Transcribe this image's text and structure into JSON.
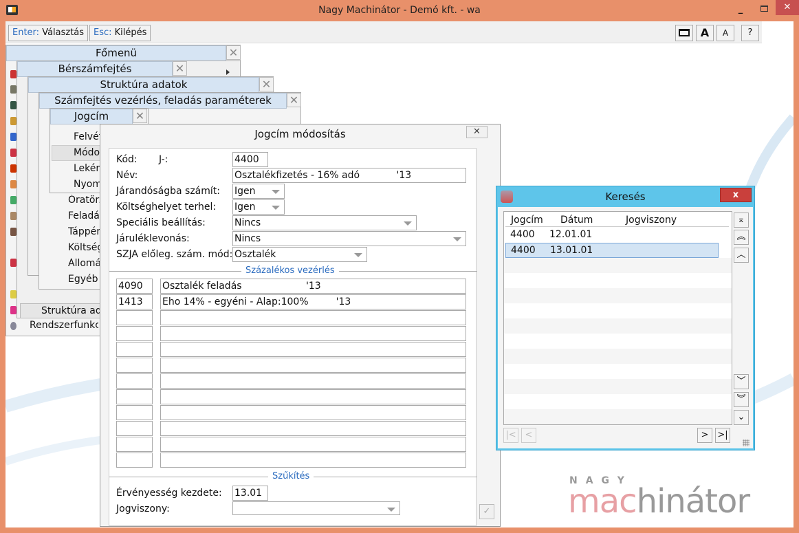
{
  "window": {
    "title": "Nagy Machinátor - Demó kft. - wa"
  },
  "toolbar": {
    "enter_key": "Enter:",
    "enter_label": "Választás",
    "esc_key": "Esc:",
    "esc_label": "Kilépés",
    "btn_window": "",
    "btn_font_large": "A",
    "btn_font_small": "A",
    "btn_help": "?"
  },
  "menus": {
    "fomenu": {
      "title": "Főmenü",
      "item_last": "Rendszerfunkciók"
    },
    "berszam": {
      "title": "Bérszámfejtés",
      "item_bottom": "Struktúra adatok"
    },
    "struktura": {
      "title": "Struktúra adatok"
    },
    "szamfejtes": {
      "title": "Számfejtés vezérlés, feladás paraméterek",
      "items": [
        "Óratörzs",
        "Feladás",
        "Táppénz",
        "Költségh",
        "Állomány",
        "Egyéb st"
      ]
    },
    "jogcim": {
      "title": "Jogcím",
      "items": [
        "Felvétel",
        "Módosítás",
        "Lekérdezés",
        "Nyomtatás"
      ]
    }
  },
  "dialog": {
    "title": "Jogcím módosítás",
    "kod_label": "Kód:",
    "j_label": "J-:",
    "kod_value": "4400",
    "nev_label": "Név:",
    "nev_value": "Osztalékfizetés - 16% adó            '13",
    "jarandosag_label": "Járandóságba számít:",
    "jarandosag_value": "Igen",
    "koltseg_label": "Költséghelyet terhel:",
    "koltseg_value": "Igen",
    "specialis_label": "Speciális beállítás:",
    "specialis_value": "Nincs",
    "jarulek_label": "Járuléklevonás:",
    "jarulek_value": "Nincs",
    "szja_label": "SZJA előleg. szám. mód:",
    "szja_value": "Osztalék",
    "section_percent": "Százalékos vezérlés",
    "percent_rows": [
      {
        "code": "4090",
        "name": "Osztalék feladás                     '13"
      },
      {
        "code": "1413",
        "name": "Eho 14% - egyéni - Alap:100%         '13"
      },
      {
        "code": "",
        "name": ""
      },
      {
        "code": "",
        "name": ""
      },
      {
        "code": "",
        "name": ""
      },
      {
        "code": "",
        "name": ""
      },
      {
        "code": "",
        "name": ""
      },
      {
        "code": "",
        "name": ""
      },
      {
        "code": "",
        "name": ""
      },
      {
        "code": "",
        "name": ""
      },
      {
        "code": "",
        "name": ""
      },
      {
        "code": "",
        "name": ""
      }
    ],
    "section_filter": "Szűkítés",
    "ervenyesseg_label": "Érvényesség kezdete:",
    "ervenyesseg_value": "13.01",
    "jogviszony_label": "Jogviszony:",
    "jogviszony_value": ""
  },
  "search": {
    "title": "Keresés",
    "close": "x",
    "columns": [
      "Jogcím",
      "Dátum",
      "Jogviszony"
    ],
    "rows": [
      {
        "jogcim": "4400",
        "datum": "12.01.01",
        "jogviszony": ""
      },
      {
        "jogcim": "4400",
        "datum": "13.01.01",
        "jogviszony": ""
      }
    ],
    "selected_row": 1
  },
  "logo": {
    "top": "NAGY",
    "main": "machinátor"
  }
}
